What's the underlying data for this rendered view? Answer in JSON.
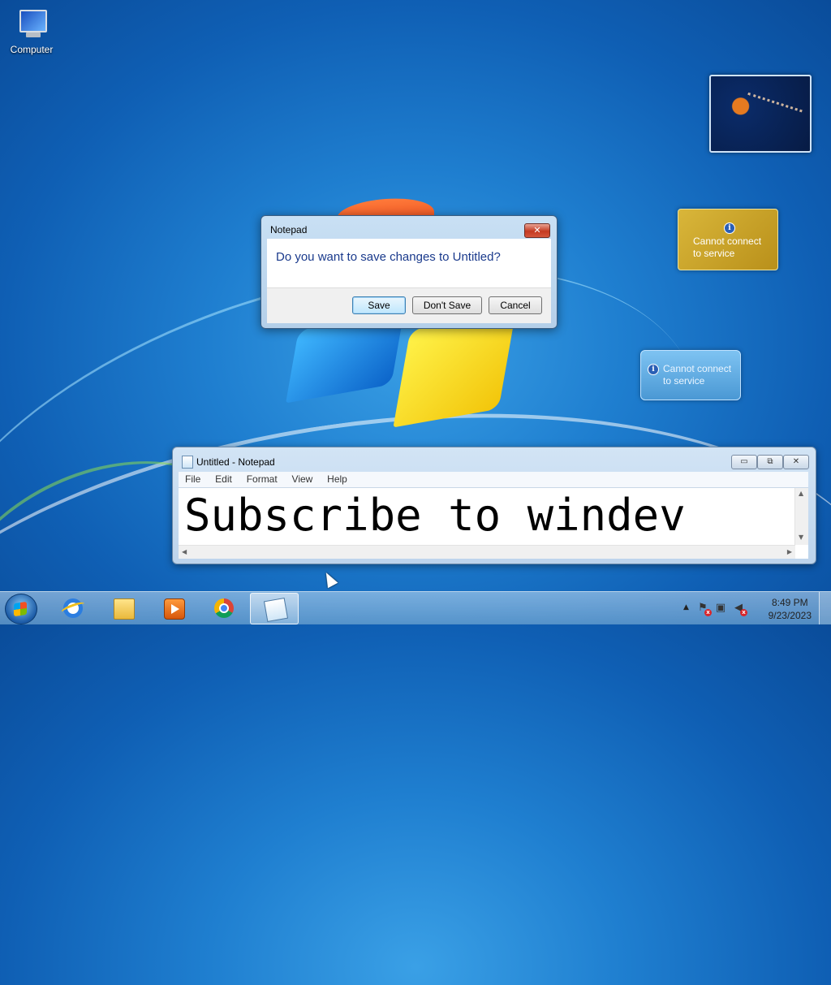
{
  "desktop": {
    "icons": [
      {
        "label": "Computer",
        "icon": "computer-icon"
      }
    ]
  },
  "gadgets": {
    "slideshow": {
      "icon": "jellyfish-photo"
    },
    "card1": {
      "message_line1": "Cannot connect",
      "message_line2": "to service",
      "icon": "info-icon"
    },
    "card2": {
      "message_line1": "Cannot connect",
      "message_line2": "to service",
      "icon": "info-icon"
    }
  },
  "dialog": {
    "title": "Notepad",
    "close_label": "✕",
    "question": "Do you want to save changes to Untitled?",
    "buttons": {
      "save": "Save",
      "dont_save": "Don't Save",
      "cancel": "Cancel"
    }
  },
  "notepad": {
    "title": "Untitled - Notepad",
    "menu": [
      "File",
      "Edit",
      "Format",
      "View",
      "Help"
    ],
    "content": "Subscribe to windev",
    "window_buttons": {
      "minimize": "▭",
      "maximize": "⧉",
      "close": "✕"
    }
  },
  "taskbar": {
    "apps": [
      "internet-explorer",
      "windows-explorer",
      "windows-media-player",
      "google-chrome",
      "notepad"
    ],
    "tray": {
      "show_hidden": "▲",
      "clock_time": "8:49 PM",
      "clock_date": "9/23/2023"
    }
  },
  "colors": {
    "desktop_bg": "#1f7fd0",
    "dialog_text": "#1a3a8c",
    "close_red": "#c43a22"
  }
}
